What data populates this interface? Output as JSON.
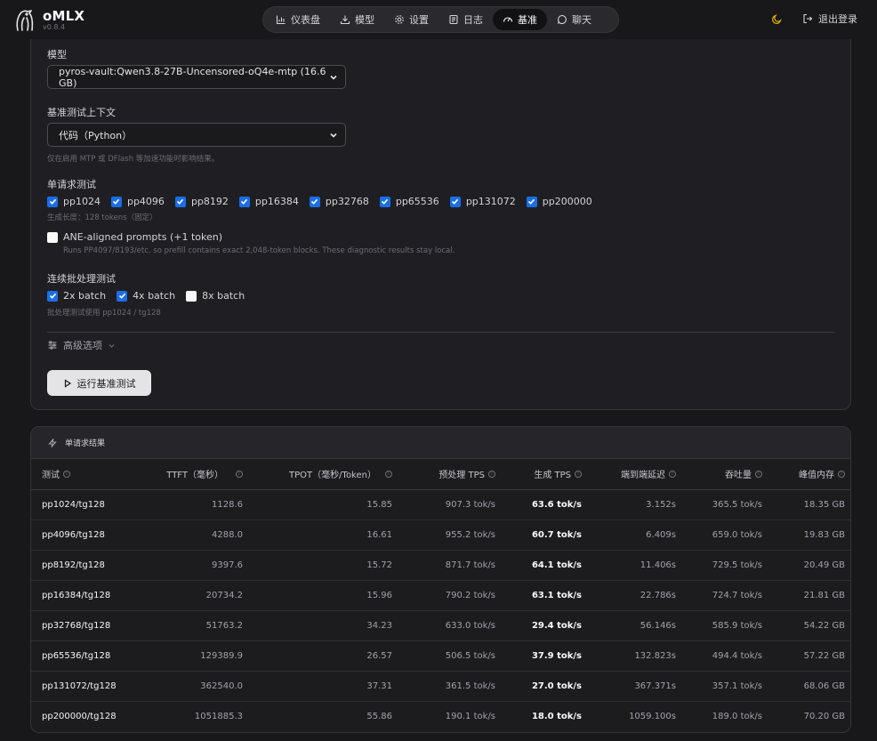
{
  "app": {
    "name": "oMLX",
    "version": "v0.8.4"
  },
  "nav": [
    {
      "label": "仪表盘",
      "icon": "bar-chart-icon",
      "active": false
    },
    {
      "label": "模型",
      "icon": "download-icon",
      "active": false
    },
    {
      "label": "设置",
      "icon": "gear-icon",
      "active": false
    },
    {
      "label": "日志",
      "icon": "log-icon",
      "active": false
    },
    {
      "label": "基准",
      "icon": "gauge-icon",
      "active": true
    },
    {
      "label": "聊天",
      "icon": "chat-icon",
      "active": false
    }
  ],
  "header": {
    "logout_label": "退出登录",
    "theme_icon": "moon-icon"
  },
  "config": {
    "model_label": "模型",
    "model_value": "pyros-vault:Qwen3.8-27B-Uncensored-oQ4e-mtp (16.6 GB)",
    "context_label": "基准测试上下文",
    "context_value": "代码（Python）",
    "context_hint": "仅在启用 MTP 或 DFlash 等加速功能时影响结果。",
    "single_label": "单请求测试",
    "single_tests": [
      {
        "label": "pp1024",
        "checked": true
      },
      {
        "label": "pp4096",
        "checked": true
      },
      {
        "label": "pp8192",
        "checked": true
      },
      {
        "label": "pp16384",
        "checked": true
      },
      {
        "label": "pp32768",
        "checked": true
      },
      {
        "label": "pp65536",
        "checked": true
      },
      {
        "label": "pp131072",
        "checked": true
      },
      {
        "label": "pp200000",
        "checked": true
      }
    ],
    "gen_hint": "生成长度：128 tokens（固定）",
    "ane_label": "ANE-aligned prompts (+1 token)",
    "ane_checked": false,
    "ane_hint": "Runs PP4097/8193/etc. so prefill contains exact 2,048-token blocks. These diagnostic results stay local.",
    "batch_label": "连续批处理测试",
    "batch_tests": [
      {
        "label": "2x batch",
        "checked": true
      },
      {
        "label": "4x batch",
        "checked": true
      },
      {
        "label": "8x batch",
        "checked": false
      }
    ],
    "batch_hint": "批处理测试使用 pp1024 / tg128",
    "advanced_label": "高级选项",
    "run_label": "运行基准测试"
  },
  "results": {
    "title": "单请求结果",
    "columns": [
      "测试",
      "TTFT（毫秒）",
      "TPOT（毫秒/Token）",
      "预处理 TPS",
      "生成 TPS",
      "端到端延迟",
      "吞吐量",
      "峰值内存"
    ],
    "rows": [
      [
        "pp1024/tg128",
        "1128.6",
        "15.85",
        "907.3 tok/s",
        "63.6 tok/s",
        "3.152s",
        "365.5 tok/s",
        "18.35 GB"
      ],
      [
        "pp4096/tg128",
        "4288.0",
        "16.61",
        "955.2 tok/s",
        "60.7 tok/s",
        "6.409s",
        "659.0 tok/s",
        "19.83 GB"
      ],
      [
        "pp8192/tg128",
        "9397.6",
        "15.72",
        "871.7 tok/s",
        "64.1 tok/s",
        "11.406s",
        "729.5 tok/s",
        "20.49 GB"
      ],
      [
        "pp16384/tg128",
        "20734.2",
        "15.96",
        "790.2 tok/s",
        "63.1 tok/s",
        "22.786s",
        "724.7 tok/s",
        "21.81 GB"
      ],
      [
        "pp32768/tg128",
        "51763.2",
        "34.23",
        "633.0 tok/s",
        "29.4 tok/s",
        "56.146s",
        "585.9 tok/s",
        "54.22 GB"
      ],
      [
        "pp65536/tg128",
        "129389.9",
        "26.57",
        "506.5 tok/s",
        "37.9 tok/s",
        "132.823s",
        "494.4 tok/s",
        "57.22 GB"
      ],
      [
        "pp131072/tg128",
        "362540.0",
        "37.31",
        "361.5 tok/s",
        "27.0 tok/s",
        "367.371s",
        "357.1 tok/s",
        "68.06 GB"
      ],
      [
        "pp200000/tg128",
        "1051885.3",
        "55.86",
        "190.1 tok/s",
        "18.0 tok/s",
        "1059.100s",
        "189.0 tok/s",
        "70.20 GB"
      ]
    ]
  },
  "colors": {
    "accent": "#1a6ee8",
    "background": "#18181b",
    "card": "#1f1f23"
  }
}
